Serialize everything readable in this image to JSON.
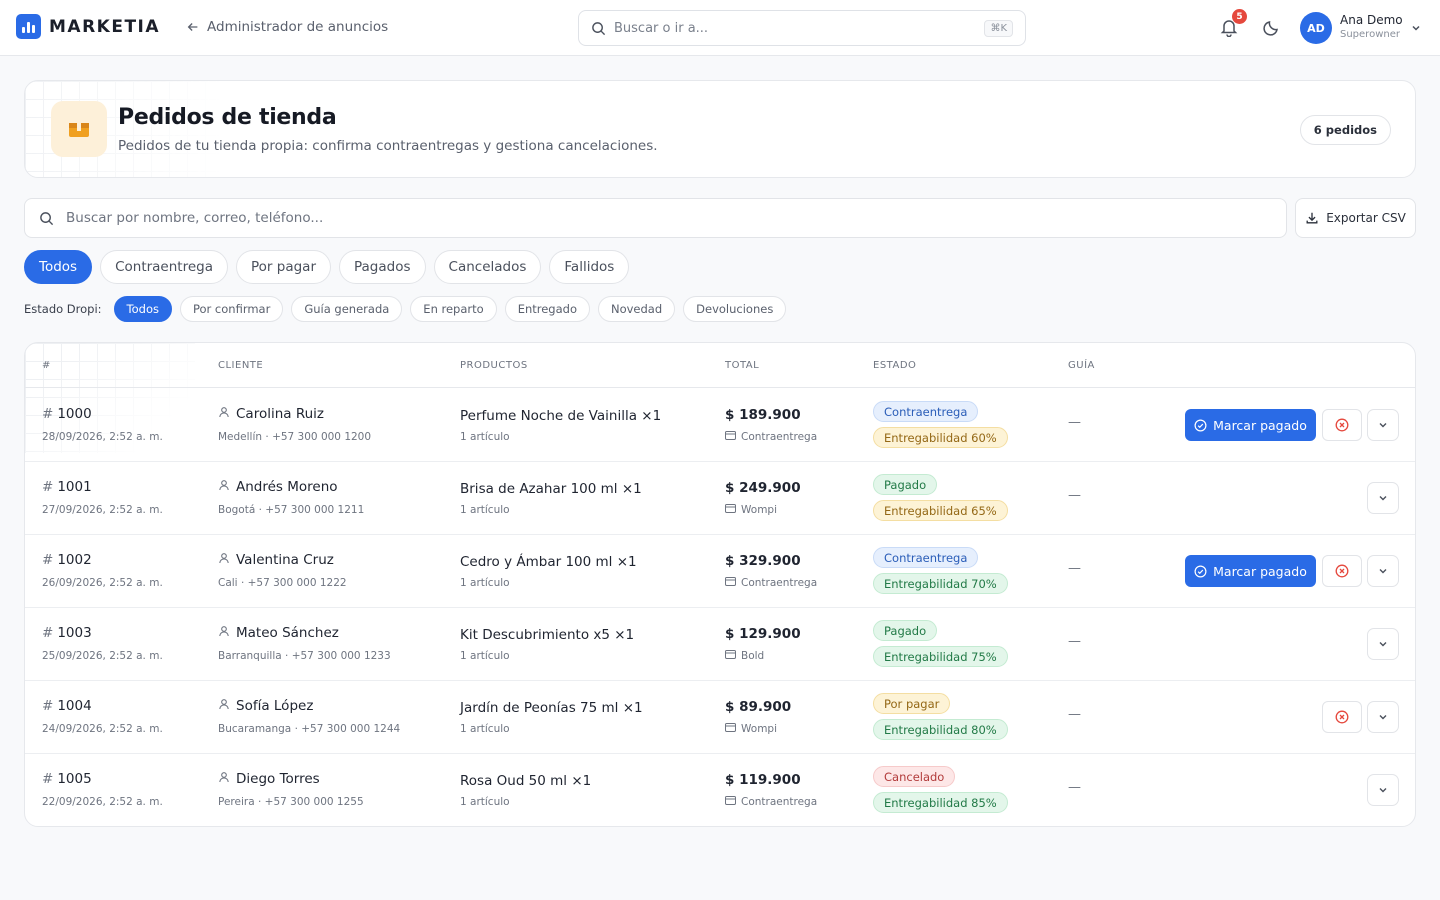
{
  "topbar": {
    "brand": "MARKETIA",
    "back_label": "Administrador de anuncios",
    "search_placeholder": "Buscar o ir a...",
    "search_shortcut": "⌘K",
    "notification_count": "5",
    "user_initials": "AD",
    "user_name": "Ana Demo",
    "user_role": "Superowner",
    "brand_color": "#2a6be6"
  },
  "header": {
    "title": "Pedidos de tienda",
    "subtitle": "Pedidos de tu tienda propia: confirma contraentregas y gestiona cancelaciones.",
    "count_label": "6 pedidos"
  },
  "search": {
    "placeholder": "Buscar por nombre, correo, teléfono...",
    "export_label": "Exportar CSV"
  },
  "tabs": [
    "Todos",
    "Contraentrega",
    "Por pagar",
    "Pagados",
    "Cancelados",
    "Fallidos"
  ],
  "active_tab": "Todos",
  "dropi": {
    "label": "Estado Dropi:",
    "chips": [
      "Todos",
      "Por confirmar",
      "Guía generada",
      "En reparto",
      "Entregado",
      "Novedad",
      "Devoluciones"
    ],
    "active": "Todos"
  },
  "table": {
    "headers": {
      "num": "#",
      "client": "CLIENTE",
      "products": "PRODUCTOS",
      "total": "TOTAL",
      "status": "ESTADO",
      "guide": "GUÍA"
    },
    "mark_paid_label": "Marcar pagado",
    "rows": [
      {
        "id": "1000",
        "date": "28/09/2026, 2:52 a. m.",
        "client": "Carolina Ruiz",
        "meta": "Medellín · +57 300 000 1200",
        "product": "Perfume Noche de Vainilla ×1",
        "count": "1 artículo",
        "total": "$ 189.900",
        "method": "Contraentrega",
        "status": "Contraentrega",
        "status_color": "blue",
        "deliver": "Entregabilidad 60%",
        "deliver_color": "yellow",
        "guide": "—",
        "mark_paid": true,
        "cancel": true
      },
      {
        "id": "1001",
        "date": "27/09/2026, 2:52 a. m.",
        "client": "Andrés Moreno",
        "meta": "Bogotá · +57 300 000 1211",
        "product": "Brisa de Azahar 100 ml ×1",
        "count": "1 artículo",
        "total": "$ 249.900",
        "method": "Wompi",
        "status": "Pagado",
        "status_color": "green",
        "deliver": "Entregabilidad 65%",
        "deliver_color": "yellow",
        "guide": "—",
        "mark_paid": false,
        "cancel": false
      },
      {
        "id": "1002",
        "date": "26/09/2026, 2:52 a. m.",
        "client": "Valentina Cruz",
        "meta": "Cali · +57 300 000 1222",
        "product": "Cedro y Ámbar 100 ml ×1",
        "count": "1 artículo",
        "total": "$ 329.900",
        "method": "Contraentrega",
        "status": "Contraentrega",
        "status_color": "blue",
        "deliver": "Entregabilidad 70%",
        "deliver_color": "green",
        "guide": "—",
        "mark_paid": true,
        "cancel": true
      },
      {
        "id": "1003",
        "date": "25/09/2026, 2:52 a. m.",
        "client": "Mateo Sánchez",
        "meta": "Barranquilla · +57 300 000 1233",
        "product": "Kit Descubrimiento x5 ×1",
        "count": "1 artículo",
        "total": "$ 129.900",
        "method": "Bold",
        "status": "Pagado",
        "status_color": "green",
        "deliver": "Entregabilidad 75%",
        "deliver_color": "green",
        "guide": "—",
        "mark_paid": false,
        "cancel": false
      },
      {
        "id": "1004",
        "date": "24/09/2026, 2:52 a. m.",
        "client": "Sofía López",
        "meta": "Bucaramanga · +57 300 000 1244",
        "product": "Jardín de Peonías 75 ml ×1",
        "count": "1 artículo",
        "total": "$ 89.900",
        "method": "Wompi",
        "status": "Por pagar",
        "status_color": "yellow",
        "deliver": "Entregabilidad 80%",
        "deliver_color": "green",
        "guide": "—",
        "mark_paid": false,
        "cancel": true
      },
      {
        "id": "1005",
        "date": "22/09/2026, 2:52 a. m.",
        "client": "Diego Torres",
        "meta": "Pereira · +57 300 000 1255",
        "product": "Rosa Oud 50 ml ×1",
        "count": "1 artículo",
        "total": "$ 119.900",
        "method": "Contraentrega",
        "status": "Cancelado",
        "status_color": "red",
        "deliver": "Entregabilidad 85%",
        "deliver_color": "green",
        "guide": "—",
        "mark_paid": false,
        "cancel": false
      }
    ]
  }
}
